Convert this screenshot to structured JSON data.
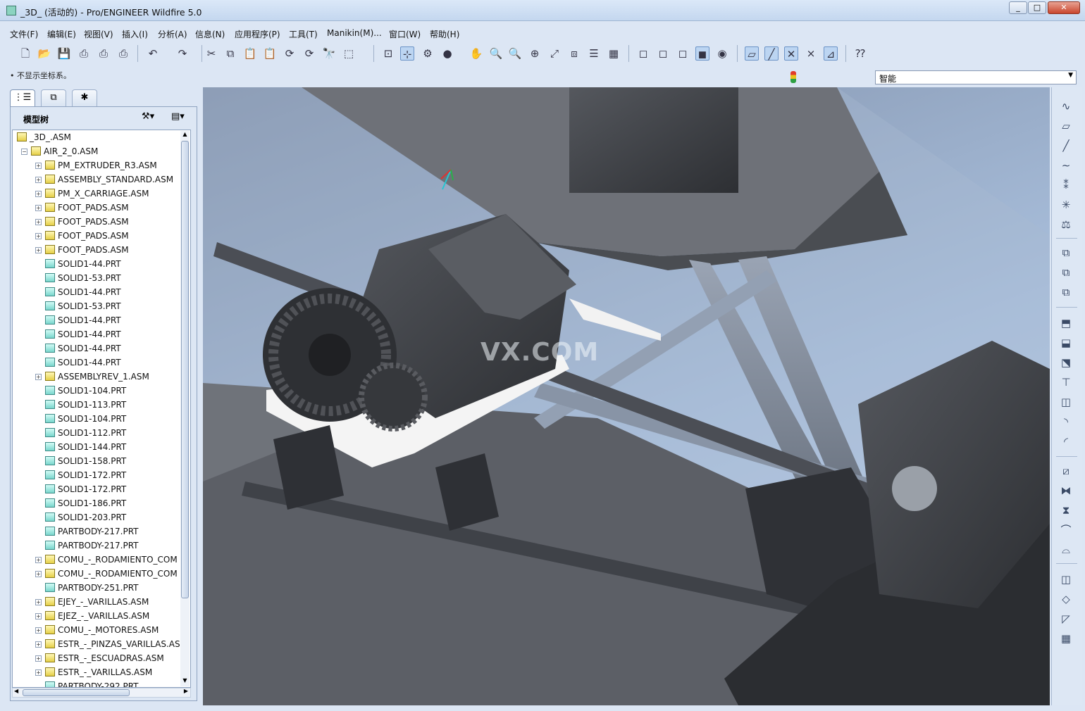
{
  "window": {
    "title": "_3D_ (活动的) - Pro/ENGINEER Wildfire 5.0",
    "min": "0",
    "max": "1",
    "close": "r"
  },
  "menu": [
    "文件(F)",
    "编辑(E)",
    "视图(V)",
    "插入(I)",
    "分析(A)",
    "信息(N)",
    "应用程序(P)",
    "工具(T)",
    "Manikin(M)...",
    "窗口(W)",
    "帮助(H)"
  ],
  "status": {
    "message": "• 不显示坐标系。"
  },
  "filter": {
    "value": "智能"
  },
  "navigator": {
    "tabs": [
      "model-tree",
      "layers",
      "favorites"
    ],
    "title": "模型树",
    "tree": [
      {
        "label": "_3D_.ASM",
        "kind": "asm",
        "level": 0,
        "expand": ""
      },
      {
        "label": "AIR_2_0.ASM",
        "kind": "asm",
        "level": 1,
        "expand": "-"
      },
      {
        "label": "PM_EXTRUDER_R3.ASM",
        "kind": "asm",
        "level": 2,
        "expand": "+"
      },
      {
        "label": "ASSEMBLY_STANDARD.ASM",
        "kind": "asm",
        "level": 2,
        "expand": "+"
      },
      {
        "label": "PM_X_CARRIAGE.ASM",
        "kind": "asm",
        "level": 2,
        "expand": "+"
      },
      {
        "label": "FOOT_PADS.ASM",
        "kind": "asm",
        "level": 2,
        "expand": "+"
      },
      {
        "label": "FOOT_PADS.ASM",
        "kind": "asm",
        "level": 2,
        "expand": "+"
      },
      {
        "label": "FOOT_PADS.ASM",
        "kind": "asm",
        "level": 2,
        "expand": "+"
      },
      {
        "label": "FOOT_PADS.ASM",
        "kind": "asm",
        "level": 2,
        "expand": "+"
      },
      {
        "label": "SOLID1-44.PRT",
        "kind": "prt",
        "level": 2,
        "expand": ""
      },
      {
        "label": "SOLID1-53.PRT",
        "kind": "prt",
        "level": 2,
        "expand": ""
      },
      {
        "label": "SOLID1-44.PRT",
        "kind": "prt",
        "level": 2,
        "expand": ""
      },
      {
        "label": "SOLID1-53.PRT",
        "kind": "prt",
        "level": 2,
        "expand": ""
      },
      {
        "label": "SOLID1-44.PRT",
        "kind": "prt",
        "level": 2,
        "expand": ""
      },
      {
        "label": "SOLID1-44.PRT",
        "kind": "prt",
        "level": 2,
        "expand": ""
      },
      {
        "label": "SOLID1-44.PRT",
        "kind": "prt",
        "level": 2,
        "expand": ""
      },
      {
        "label": "SOLID1-44.PRT",
        "kind": "prt",
        "level": 2,
        "expand": ""
      },
      {
        "label": "ASSEMBLYREV_1.ASM",
        "kind": "asm",
        "level": 2,
        "expand": "+"
      },
      {
        "label": "SOLID1-104.PRT",
        "kind": "prt",
        "level": 2,
        "expand": ""
      },
      {
        "label": "SOLID1-113.PRT",
        "kind": "prt",
        "level": 2,
        "expand": ""
      },
      {
        "label": "SOLID1-104.PRT",
        "kind": "prt",
        "level": 2,
        "expand": ""
      },
      {
        "label": "SOLID1-112.PRT",
        "kind": "prt",
        "level": 2,
        "expand": ""
      },
      {
        "label": "SOLID1-144.PRT",
        "kind": "prt",
        "level": 2,
        "expand": ""
      },
      {
        "label": "SOLID1-158.PRT",
        "kind": "prt",
        "level": 2,
        "expand": ""
      },
      {
        "label": "SOLID1-172.PRT",
        "kind": "prt",
        "level": 2,
        "expand": ""
      },
      {
        "label": "SOLID1-172.PRT",
        "kind": "prt",
        "level": 2,
        "expand": ""
      },
      {
        "label": "SOLID1-186.PRT",
        "kind": "prt",
        "level": 2,
        "expand": ""
      },
      {
        "label": "SOLID1-203.PRT",
        "kind": "prt",
        "level": 2,
        "expand": ""
      },
      {
        "label": "PARTBODY-217.PRT",
        "kind": "prt",
        "level": 2,
        "expand": ""
      },
      {
        "label": "PARTBODY-217.PRT",
        "kind": "prt",
        "level": 2,
        "expand": ""
      },
      {
        "label": "COMU_-_RODAMIENTO_COM",
        "kind": "asm",
        "level": 2,
        "expand": "+"
      },
      {
        "label": "COMU_-_RODAMIENTO_COM",
        "kind": "asm",
        "level": 2,
        "expand": "+"
      },
      {
        "label": "PARTBODY-251.PRT",
        "kind": "prt",
        "level": 2,
        "expand": ""
      },
      {
        "label": "EJEY_-_VARILLAS.ASM",
        "kind": "asm",
        "level": 2,
        "expand": "+"
      },
      {
        "label": "EJEZ_-_VARILLAS.ASM",
        "kind": "asm",
        "level": 2,
        "expand": "+"
      },
      {
        "label": "COMU_-_MOTORES.ASM",
        "kind": "asm",
        "level": 2,
        "expand": "+"
      },
      {
        "label": "ESTR_-_PINZAS_VARILLAS.ASM",
        "kind": "asm",
        "level": 2,
        "expand": "+"
      },
      {
        "label": "ESTR_-_ESCUADRAS.ASM",
        "kind": "asm",
        "level": 2,
        "expand": "+"
      },
      {
        "label": "ESTR_-_VARILLAS.ASM",
        "kind": "asm",
        "level": 2,
        "expand": "+"
      },
      {
        "label": "PARTBODY-292.PRT",
        "kind": "prt",
        "level": 2,
        "expand": ""
      }
    ]
  },
  "toolbar_icons": [
    "new-file",
    "open",
    "save",
    "print",
    "print-preview",
    "quick-print",
    "undo",
    "redo",
    "cut",
    "copy",
    "paste",
    "paste-special",
    "regenerate",
    "regenerate-manager",
    "find",
    "select-box",
    "repaint",
    "spin-center",
    "datum-display",
    "appearance",
    "pan",
    "zoom-in",
    "zoom-out",
    "refit",
    "reorient",
    "saved-views",
    "layers",
    "view-manager",
    "wireframe",
    "hidden-line",
    "no-hidden",
    "shading",
    "enhanced-realism",
    "datum-planes",
    "datum-axes",
    "datum-points",
    "coordinate-systems",
    "annotation-display",
    "whats-this"
  ],
  "right_toolbar_icons": [
    "sketch",
    "datum-plane",
    "datum-axis",
    "datum-curve",
    "datum-point",
    "datum-csys",
    "analysis",
    "component-assemble",
    "component-create",
    "component-package",
    "extrude",
    "revolve",
    "sweep",
    "hole",
    "round",
    "chamfer",
    "draft",
    "shell",
    "mirror",
    "merge",
    "trim",
    "offset",
    "thicken",
    "pattern",
    "copy",
    "paste",
    "fill-pattern"
  ],
  "viewport": {
    "watermark": "VX.COM"
  },
  "colors": {
    "viewport_bg_top": "#7f8fa9",
    "viewport_bg_bottom": "#c8d8ee",
    "part_dark": "#3e4046",
    "part_gray": "#6b6e74",
    "rod": "#7a8494",
    "white_part": "#f4f4f4"
  }
}
